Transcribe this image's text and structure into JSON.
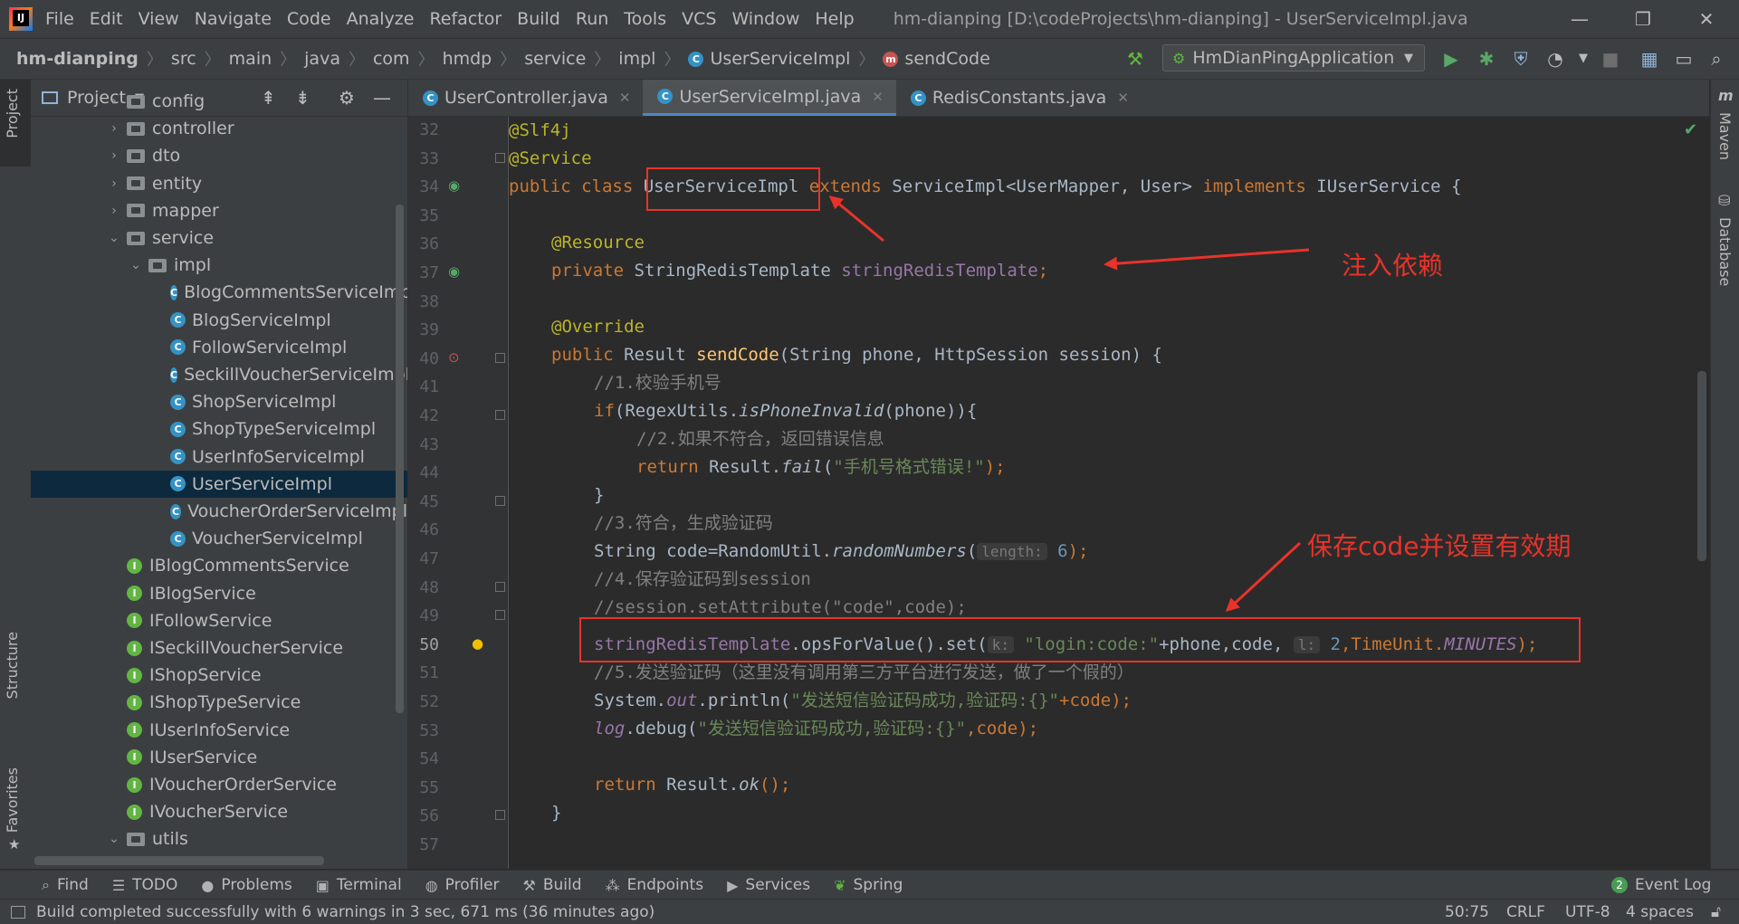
{
  "menu": {
    "items": [
      "File",
      "Edit",
      "View",
      "Navigate",
      "Code",
      "Analyze",
      "Refactor",
      "Build",
      "Run",
      "Tools",
      "VCS",
      "Window",
      "Help"
    ],
    "window_title": "hm-dianping [D:\\codeProjects\\hm-dianping] - UserServiceImpl.java"
  },
  "breadcrumb": {
    "project": "hm-dianping",
    "parts": [
      "src",
      "main",
      "java",
      "com",
      "hmdp",
      "service",
      "impl"
    ],
    "class": "UserServiceImpl",
    "method": "sendCode"
  },
  "run_config": {
    "label": "HmDianPingApplication"
  },
  "project_panel": {
    "title": "Project",
    "items": [
      {
        "label": "config",
        "kind": "folder",
        "depth": 2,
        "expanded": false
      },
      {
        "label": "controller",
        "kind": "folder",
        "depth": 2,
        "expanded": false
      },
      {
        "label": "dto",
        "kind": "folder",
        "depth": 2,
        "expanded": false
      },
      {
        "label": "entity",
        "kind": "folder",
        "depth": 2,
        "expanded": false
      },
      {
        "label": "mapper",
        "kind": "folder",
        "depth": 2,
        "expanded": false
      },
      {
        "label": "service",
        "kind": "folder",
        "depth": 2,
        "expanded": true
      },
      {
        "label": "impl",
        "kind": "folder",
        "depth": 3,
        "expanded": true
      },
      {
        "label": "BlogCommentsServiceImpl",
        "kind": "class",
        "depth": 4
      },
      {
        "label": "BlogServiceImpl",
        "kind": "class",
        "depth": 4
      },
      {
        "label": "FollowServiceImpl",
        "kind": "class",
        "depth": 4
      },
      {
        "label": "SeckillVoucherServiceImpl",
        "kind": "class",
        "depth": 4
      },
      {
        "label": "ShopServiceImpl",
        "kind": "class",
        "depth": 4
      },
      {
        "label": "ShopTypeServiceImpl",
        "kind": "class",
        "depth": 4
      },
      {
        "label": "UserInfoServiceImpl",
        "kind": "class",
        "depth": 4
      },
      {
        "label": "UserServiceImpl",
        "kind": "class",
        "depth": 4,
        "selected": true
      },
      {
        "label": "VoucherOrderServiceImpl",
        "kind": "class",
        "depth": 4
      },
      {
        "label": "VoucherServiceImpl",
        "kind": "class",
        "depth": 4
      },
      {
        "label": "IBlogCommentsService",
        "kind": "interface",
        "depth": 3
      },
      {
        "label": "IBlogService",
        "kind": "interface",
        "depth": 3
      },
      {
        "label": "IFollowService",
        "kind": "interface",
        "depth": 3
      },
      {
        "label": "ISeckillVoucherService",
        "kind": "interface",
        "depth": 3
      },
      {
        "label": "IShopService",
        "kind": "interface",
        "depth": 3
      },
      {
        "label": "IShopTypeService",
        "kind": "interface",
        "depth": 3
      },
      {
        "label": "IUserInfoService",
        "kind": "interface",
        "depth": 3
      },
      {
        "label": "IUserService",
        "kind": "interface",
        "depth": 3
      },
      {
        "label": "IVoucherOrderService",
        "kind": "interface",
        "depth": 3
      },
      {
        "label": "IVoucherService",
        "kind": "interface",
        "depth": 3
      },
      {
        "label": "utils",
        "kind": "folder",
        "depth": 2,
        "expanded": true
      }
    ]
  },
  "tabs": [
    {
      "label": "UserController.java",
      "active": false
    },
    {
      "label": "UserServiceImpl.java",
      "active": true
    },
    {
      "label": "RedisConstants.java",
      "active": false
    }
  ],
  "editor": {
    "line_numbers": [
      32,
      33,
      34,
      35,
      36,
      37,
      38,
      39,
      40,
      41,
      42,
      43,
      44,
      45,
      46,
      47,
      48,
      49,
      50,
      51,
      52,
      53,
      54,
      55,
      56,
      57
    ],
    "current_line": 50,
    "code": {
      "l32": "@Slf4j",
      "l33": "@Service",
      "l34_kw": "public class ",
      "l34_cls": "UserServiceImpl",
      "l34_ext": " extends ",
      "l34_rest": "ServiceImpl<UserMapper, User> ",
      "l34_impl": "implements",
      "l34_end": " IUserService {",
      "l36": "@Resource",
      "l37_kw": "private ",
      "l37_type": "StringRedisTemplate ",
      "l37_fld": "stringRedisTemplate",
      "l37_end": ";",
      "l39": "@Override",
      "l40_kw": "public ",
      "l40_type": "Result ",
      "l40_fn": "sendCode",
      "l40_rest": "(String phone, HttpSession session) {",
      "l41": "//1.校验手机号",
      "l42_kw": "if",
      "l42_a": "(RegexUtils.",
      "l42_it": "isPhoneInvalid",
      "l42_b": "(phone)){",
      "l43": "//2.如果不符合，返回错误信息",
      "l44_kw": "return ",
      "l44_a": "Result.",
      "l44_it": "fail",
      "l44_b": "(",
      "l44_str": "\"手机号格式错误!\"",
      "l44_c": ");",
      "l45": "}",
      "l46": "//3.符合，生成验证码",
      "l47_a": "String code=RandomUtil.",
      "l47_it": "randomNumbers",
      "l47_b": "(",
      "l47_hint": "length:",
      "l47_num": " 6",
      "l47_c": ");",
      "l48": "//4.保存验证码到session",
      "l49": "//session.setAttribute(\"code\",code);",
      "l50_fld": "stringRedisTemplate",
      "l50_a": ".opsForValue().set(",
      "l50_hint_k": "k:",
      "l50_str": " \"login:code:\"",
      "l50_b": "+phone,code, ",
      "l50_hint_l": "l:",
      "l50_num": " 2",
      "l50_c": ",TimeUnit.",
      "l50_it": "MINUTES",
      "l50_d": ");",
      "l51": "//5.发送验证码（这里没有调用第三方平台进行发送，做了一个假的）",
      "l52_a": "System.",
      "l52_it": "out",
      "l52_b": ".println(",
      "l52_str": "\"发送短信验证码成功,验证码:{}\"",
      "l52_c": "+code);",
      "l53_it": "log",
      "l53_a": ".debug(",
      "l53_str": "\"发送短信验证码成功,验证码:{}\"",
      "l53_b": ",code);",
      "l55_kw": "return ",
      "l55_a": "Result.",
      "l55_it": "ok",
      "l55_b": "();",
      "l56": "}"
    }
  },
  "annotations": {
    "inject_label": "注入依赖",
    "save_label": "保存code并设置有效期"
  },
  "side_tabs": {
    "left": [
      "Project",
      "Structure",
      "Favorites"
    ],
    "right": [
      "Maven",
      "Database"
    ]
  },
  "bottom_tools": [
    "Find",
    "TODO",
    "Problems",
    "Terminal",
    "Profiler",
    "Build",
    "Endpoints",
    "Services",
    "Spring"
  ],
  "event_log": {
    "count": "2",
    "label": "Event Log"
  },
  "status": {
    "message": "Build completed successfully with 6 warnings in 3 sec, 671 ms (36 minutes ago)",
    "position": "50:75",
    "line_sep": "CRLF",
    "encoding": "UTF-8",
    "indent": "4 spaces"
  },
  "colors": {
    "accent": "#4a88c7",
    "annotation_red": "#e8332a",
    "selection": "#0d293e"
  }
}
